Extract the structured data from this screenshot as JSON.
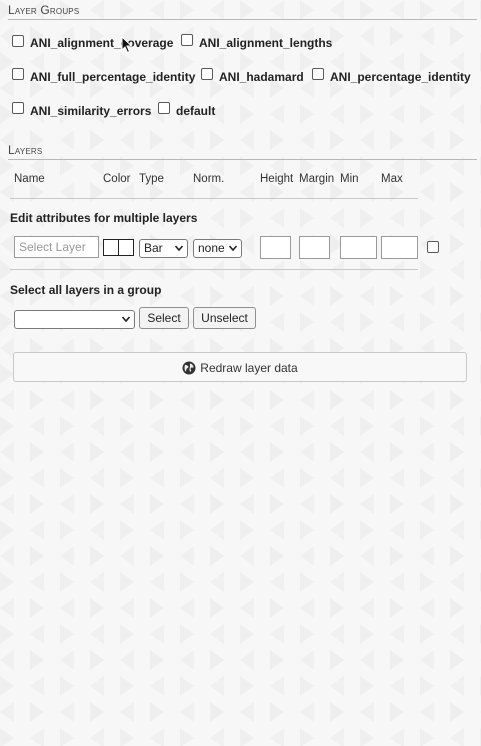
{
  "layer_groups": {
    "title": "Layer Groups",
    "items": [
      {
        "label": "ANI_alignment_coverage",
        "checked": false
      },
      {
        "label": "ANI_alignment_lengths",
        "checked": false
      },
      {
        "label": "ANI_full_percentage_identity",
        "checked": false
      },
      {
        "label": "ANI_hadamard",
        "checked": false
      },
      {
        "label": "ANI_percentage_identity",
        "checked": false
      },
      {
        "label": "ANI_similarity_errors",
        "checked": false
      },
      {
        "label": "default",
        "checked": false
      }
    ]
  },
  "layers": {
    "title": "Layers",
    "columns": [
      "Name",
      "Color",
      "Type",
      "Norm.",
      "Height",
      "Margin",
      "Min",
      "Max"
    ],
    "edit_multiple": {
      "label": "Edit attributes for multiple layers",
      "select_layer_placeholder": "Select Layer",
      "type_value": "Bar",
      "norm_value": "none",
      "height_value": "",
      "margin_value": "",
      "min_value": "",
      "max_value": "",
      "checked": false
    },
    "select_group": {
      "label": "Select all layers in a group",
      "selected_value": "",
      "select_button": "Select",
      "unselect_button": "Unselect"
    }
  },
  "redraw_button": {
    "label": "Redraw layer data",
    "icon": "globe-icon"
  },
  "colors": {
    "background": "#f7f7f7",
    "rule": "#b8b8b8",
    "button_bg": "#f3f3f3"
  }
}
